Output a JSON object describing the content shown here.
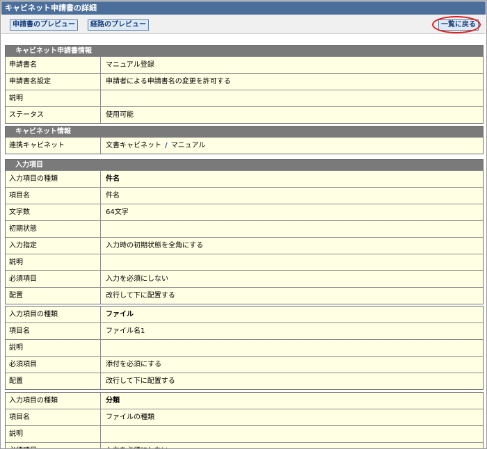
{
  "window": {
    "title": "キャビネット申請書の詳細"
  },
  "toolbar": {
    "preview_form": "申請書のプレビュー",
    "preview_route": "経路のプレビュー",
    "back_to_list": "一覧に戻る"
  },
  "form_info": {
    "header": "キャビネット申請書情報",
    "rows": [
      {
        "label": "申請書名",
        "value": "マニュアル登録"
      },
      {
        "label": "申請書名設定",
        "value": "申請者による申請書名の変更を許可する"
      },
      {
        "label": "説明",
        "value": ""
      },
      {
        "label": "ステータス",
        "value": "使用可能"
      }
    ]
  },
  "cabinet_info": {
    "header": "キャビネット情報",
    "label": "連携キャビネット",
    "cabinet": "文書キャビネット",
    "separator": "/",
    "folder": "マニュアル"
  },
  "input_items": {
    "header": "入力項目",
    "groups": [
      {
        "rows": [
          {
            "label": "入力項目の種類",
            "value": "件名"
          },
          {
            "label": "項目名",
            "value": "件名"
          },
          {
            "label": "文字数",
            "value": "64文字"
          },
          {
            "label": "初期状態",
            "value": ""
          },
          {
            "label": "入力指定",
            "value": "入力時の初期状態を全角にする"
          },
          {
            "label": "説明",
            "value": ""
          },
          {
            "label": "必須項目",
            "value": "入力を必須にしない"
          },
          {
            "label": "配置",
            "value": "改行して下に配置する"
          }
        ]
      },
      {
        "rows": [
          {
            "label": "入力項目の種類",
            "value": "ファイル"
          },
          {
            "label": "項目名",
            "value": "ファイル名1"
          },
          {
            "label": "説明",
            "value": ""
          },
          {
            "label": "必須項目",
            "value": "添付を必須にする"
          },
          {
            "label": "配置",
            "value": "改行して下に配置する"
          }
        ]
      },
      {
        "rows": [
          {
            "label": "入力項目の種類",
            "value": "分類"
          },
          {
            "label": "項目名",
            "value": "ファイルの種類"
          },
          {
            "label": "説明",
            "value": ""
          },
          {
            "label": "必須項目",
            "value": "入力を必須にしない"
          }
        ]
      }
    ]
  },
  "colors": {
    "title_bar": "#4b6f9a",
    "section_header": "#7a7a7a",
    "row_bg": "#ffffe3",
    "highlight_ring": "#e21b1b"
  }
}
